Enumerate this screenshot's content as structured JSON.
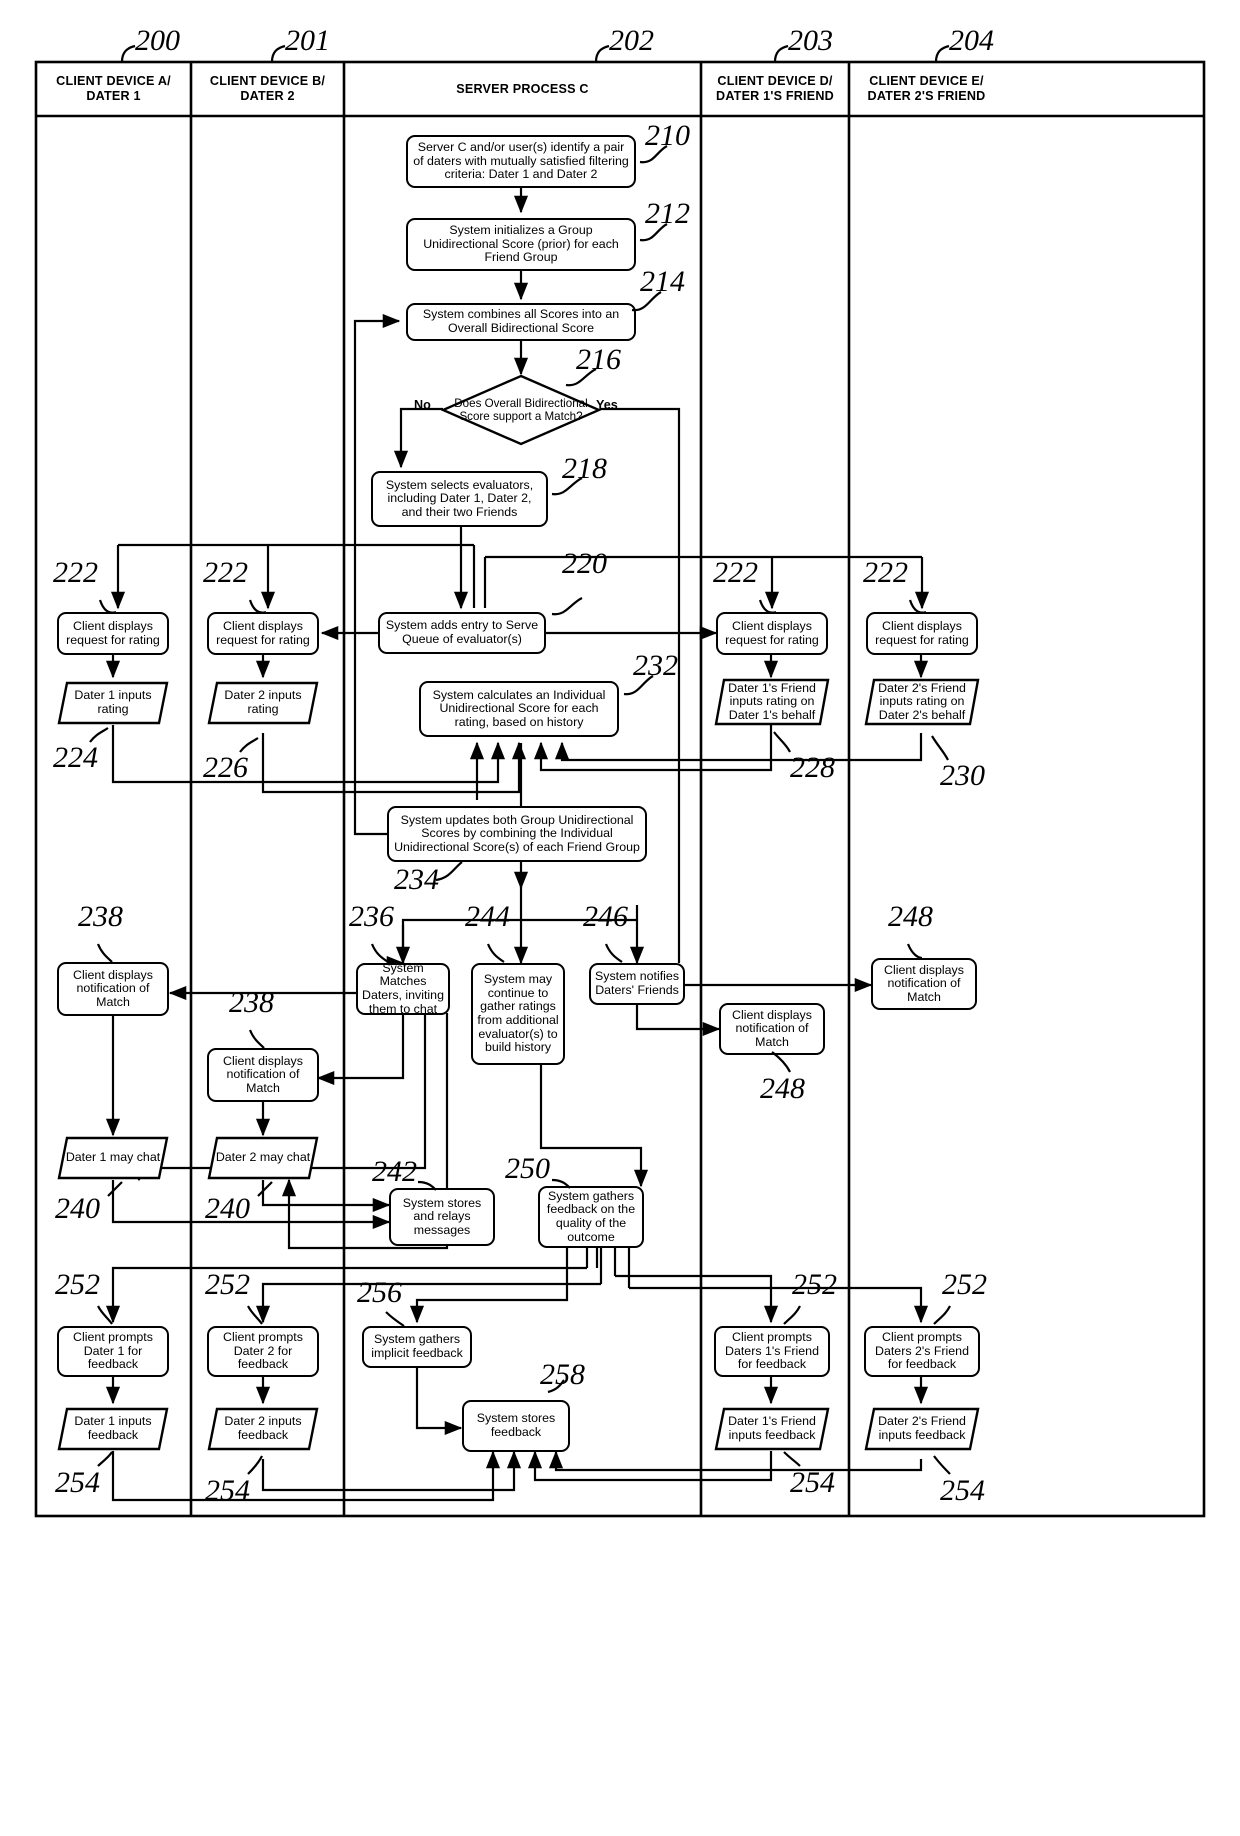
{
  "figure": {
    "type": "patent-flowchart",
    "lanes": [
      {
        "ref": "200",
        "title": "CLIENT DEVICE A/\nDATER 1"
      },
      {
        "ref": "201",
        "title": "CLIENT DEVICE B/\nDATER 2"
      },
      {
        "ref": "202",
        "title": "SERVER PROCESS C"
      },
      {
        "ref": "203",
        "title": "CLIENT DEVICE D/\nDATER 1'S FRIEND"
      },
      {
        "ref": "204",
        "title": "CLIENT DEVICE E/\nDATER 2'S FRIEND"
      }
    ],
    "lane_labels": {
      "l200": "CLIENT DEVICE A/",
      "l200b": "DATER 1",
      "l201": "CLIENT DEVICE B/",
      "l201b": "DATER 2",
      "l202": "SERVER PROCESS C",
      "l203": "CLIENT DEVICE D/",
      "l203b": "DATER 1'S FRIEND",
      "l204": "CLIENT DEVICE E/",
      "l204b": "DATER 2'S FRIEND"
    },
    "refs": {
      "r200": "200",
      "r201": "201",
      "r202": "202",
      "r203": "203",
      "r204": "204",
      "r210": "210",
      "r212": "212",
      "r214": "214",
      "r216": "216",
      "r218": "218",
      "r220": "220",
      "r222a": "222",
      "r222b": "222",
      "r222c": "222",
      "r222d": "222",
      "r224": "224",
      "r226": "226",
      "r228": "228",
      "r230": "230",
      "r232": "232",
      "r234": "234",
      "r236": "236",
      "r238a": "238",
      "r238b": "238",
      "r240a": "240",
      "r240b": "240",
      "r242": "242",
      "r244": "244",
      "r246": "246",
      "r248a": "248",
      "r248b": "248",
      "r250": "250",
      "r252a": "252",
      "r252b": "252",
      "r252c": "252",
      "r252d": "252",
      "r254a": "254",
      "r254b": "254",
      "r254c": "254",
      "r254d": "254",
      "r256": "256",
      "r258": "258"
    },
    "decision_labels": {
      "no": "No",
      "yes": "Yes"
    },
    "nodes": {
      "n210": "Server C and/or user(s) identify a pair of daters with mutually satisfied filtering criteria: Dater 1 and Dater 2",
      "n212": "System initializes a Group Unidirectional Score (prior) for each Friend Group",
      "n214": "System combines all Scores into an Overall Bidirectional Score",
      "n216": "Does Overall Bidirectional Score support a Match?",
      "n218": "System selects evaluators, including Dater 1, Dater 2, and their two Friends",
      "n220": "System adds entry to Serve Queue of evaluator(s)",
      "n222a": "Client displays request for rating",
      "n222b": "Client displays request for rating",
      "n222c": "Client displays request for rating",
      "n222d": "Client displays request for rating",
      "n224": "Dater 1 inputs rating",
      "n226": "Dater 2 inputs rating",
      "n228": "Dater 1's Friend inputs rating on Dater 1's behalf",
      "n230": "Dater 2's Friend inputs rating on Dater 2's behalf",
      "n232": "System calculates an Individual Unidirectional Score for each rating, based on history",
      "n234": "System updates both Group Unidirectional Scores by combining the Individual Unidirectional Score(s) of each Friend Group",
      "n236": "System Matches Daters, inviting them to chat",
      "n238a": "Client displays notification of Match",
      "n238b": "Client displays notification of Match",
      "n240a": "Dater 1 may chat",
      "n240b": "Dater 2 may chat",
      "n242": "System stores and relays messages",
      "n244": "System may continue to gather ratings from additional evaluator(s) to build history",
      "n246": "System notifies Daters' Friends",
      "n248a": "Client displays notification of Match",
      "n248b": "Client displays notification of Match",
      "n250": "System gathers feedback on the quality of the outcome",
      "n252a": "Client prompts Dater 1 for feedback",
      "n252b": "Client prompts Dater 2 for feedback",
      "n252c": "Client prompts Daters 1's Friend for feedback",
      "n252d": "Client prompts Daters 2's Friend for feedback",
      "n254a": "Dater 1 inputs feedback",
      "n254b": "Dater 2 inputs feedback",
      "n254c": "Dater 1's Friend inputs feedback",
      "n254d": "Dater 2's Friend inputs feedback",
      "n256": "System gathers implicit feedback",
      "n258": "System stores feedback"
    },
    "colors": {
      "line": "#000000",
      "background": "#ffffff",
      "text": "#000000"
    }
  }
}
